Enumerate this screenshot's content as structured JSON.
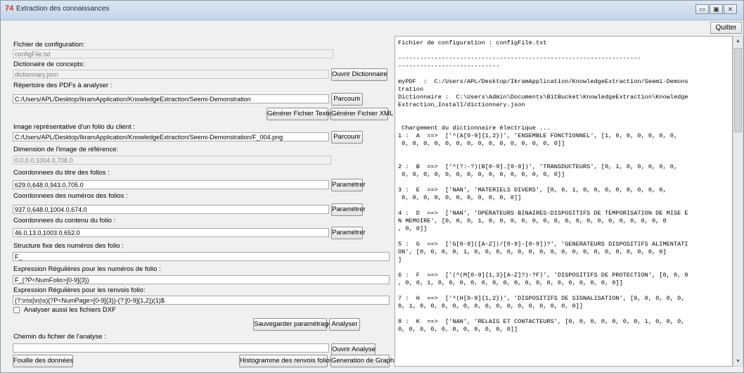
{
  "window": {
    "title": "Extraction des connaissances",
    "icon_glyph": "74",
    "icon_color": "#c0392b",
    "min_glyph": "▭",
    "max_glyph": "▣",
    "close_glyph": "✕"
  },
  "toolbar": {
    "quit_label": "Quitter"
  },
  "config": {
    "label": "Fichier de configuration:",
    "value": "configFile.txt"
  },
  "dictionary": {
    "label": "Dictionaire de concepts:",
    "value": "dictionnary.json",
    "open_label": "Ouvrir Dictionnaire"
  },
  "pdf_dir": {
    "label": "Répertoire des PDFs à analyser :",
    "value": "C:/Users/APL/Desktop/IkramApplication/KnowledgeExtraction/Seemi-Demonstration",
    "browse_label": "Parcourir",
    "gen_text_label": "Générer Fichier Texte",
    "gen_xml_label": "Générer Fichier XML"
  },
  "folio_image": {
    "label": "Image représentative d'un folio du client :",
    "value": "C:/Users/APL/Desktop/IkramApplication/KnowledgeExtraction/Seemi-Demonstration/F_004.png",
    "browse_label": "Parcourir"
  },
  "ref_dim": {
    "label": "Dimension de l'image de référence:",
    "value": "0.0,0.0,1004.0,708.0"
  },
  "title_coords": {
    "label": "Coordonnees du titre des folios :",
    "value": "629.0,648.0,943.0,705.0",
    "param_label": "Paramétrer"
  },
  "number_coords": {
    "label": "Coordonnees des numéros des folios :",
    "value": "937.0,648.0,1004.0,674.0",
    "param_label": "Paramétrer"
  },
  "content_coords": {
    "label": "Coordonnees du contenu du folio :",
    "value": "46.0,13.0,1003.0,652.0",
    "param_label": "Paramétrer"
  },
  "fixed_structure": {
    "label": "Structure fixe des numéros des folio :",
    "value": "F_"
  },
  "regex_folio": {
    "label": "Expression Régulières pour les numéros de folio :",
    "value": "F_(?P<NumFolio>[0-9]{3})"
  },
  "regex_refs": {
    "label": "Expression Régulières pour les renvois folio:",
    "value": "(?:\\n\\s|\\n|\\s)(?P<NumPage>[0-9]{3})-(?:[0-9]{1,2})(1)$"
  },
  "dxf": {
    "label": "Analyser aussi les fichiers DXF"
  },
  "actions": {
    "save_label": "Sauvegarder paramétrage",
    "analyze_label": "Analyser"
  },
  "analysis_path": {
    "label": "Chemin du fichier de l'analyse :",
    "value": "",
    "open_label": "Ouvrir Analyse"
  },
  "bottom": {
    "mining_label": "Fouille des données",
    "histogram_label": "Histogramme des renvois folios",
    "graph_label": "Generation de Graph"
  },
  "console_text": "Fichier de configuration : configFile.txt\n\n-------------------------------------------------------------------\n----------------------------\n\nmyPDF  :  C:/Users/APL/Desktop/IkramApplication/KnowledgeExtraction/Seemi-Demons\ntration\nDictionnaire :  C:\\Users\\Admin\\Documents\\BitBucket\\KnowledgeExtraction\\Knowledge\nExtraction_Install/dictionnary.json\n\n\n Chargement du dictionnaire électrique ...\n1 :  A  ==>  ['^(A[0-9]{1,2})', 'ENSEMBLE FONCTIONNEL', [1, 0, 0, 0, 0, 0, 0,\n 0, 0, 0, 0, 0, 0, 0, 0, 0, 0, 0, 0, 0, 0, 0]]\n\n\n2 :  B  ==>  ['^(?:-?)(B[0-9].[0-9])', 'TRANSDUCTEURS', [0, 1, 0, 0, 0, 0, 0,\n 0, 0, 0, 0, 0, 0, 0, 0, 0, 0, 0, 0, 0, 0, 0]]\n\n3 :  E  ==>  ['NAN', 'MATERIELS DIVERS', [0, 0, 1, 0, 0, 0, 0, 0, 0, 0, 0,\n 0, 0, 0, 0, 0, 0, 0, 0, 0, 0, 0]]\n\n4 :  D  ==>  ['NAN', 'OPERATEURS BINAIRES-DISPOSITIFS DE TEMPORISATION DE MISE E\nN MEMOIRE', [0, 0, 0, 1, 0, 0, 0, 0, 0, 0, 0, 0, 0, 0, 0, 0, 0, 0, 0, 0, 0\n, 0, 0]]\n\n5 :  G  ==>  ['G[0-9]([A-Z]|/[0-9]-[0-9])?', 'GENERATEURS DISPOSITIFS ALIMENTATI\nON', [0, 0, 0, 0, 1, 0, 0, 0, 0, 0, 0, 0, 0, 0, 0, 0, 0, 0, 0, 0, 0, 0, 0]\n]\n\n6 :  F  ==>  ['(^(M[0-9]{1,3}[A-Z]?)-?F)', 'DISPOSITIFS DE PROTECTION', [0, 0, 0\n, 0, 0, 1, 0, 0, 0, 0, 0, 0, 0, 0, 0, 0, 0, 0, 0, 0, 0, 0, 0]]\n\n7 :  H  ==>  ['^(H[0-9]{1,2})', 'DISPOSITIFS DE SIGNALISATION', [0, 0, 0, 0, 0,\n0, 1, 0, 0, 0, 0, 0, 0, 0, 0, 0, 0, 0, 0, 0, 0, 0]]\n\n8 :  K  ==>  ['NAN', 'RELAIS ET CONTACTEURS', [0, 0, 0, 0, 0, 0, 0, 1, 0, 0, 0,\n0, 0, 0, 0, 0, 0, 0, 0, 0, 0, 0]]",
  "scrollbar": {
    "up_glyph": "▲",
    "down_glyph": "▼"
  }
}
